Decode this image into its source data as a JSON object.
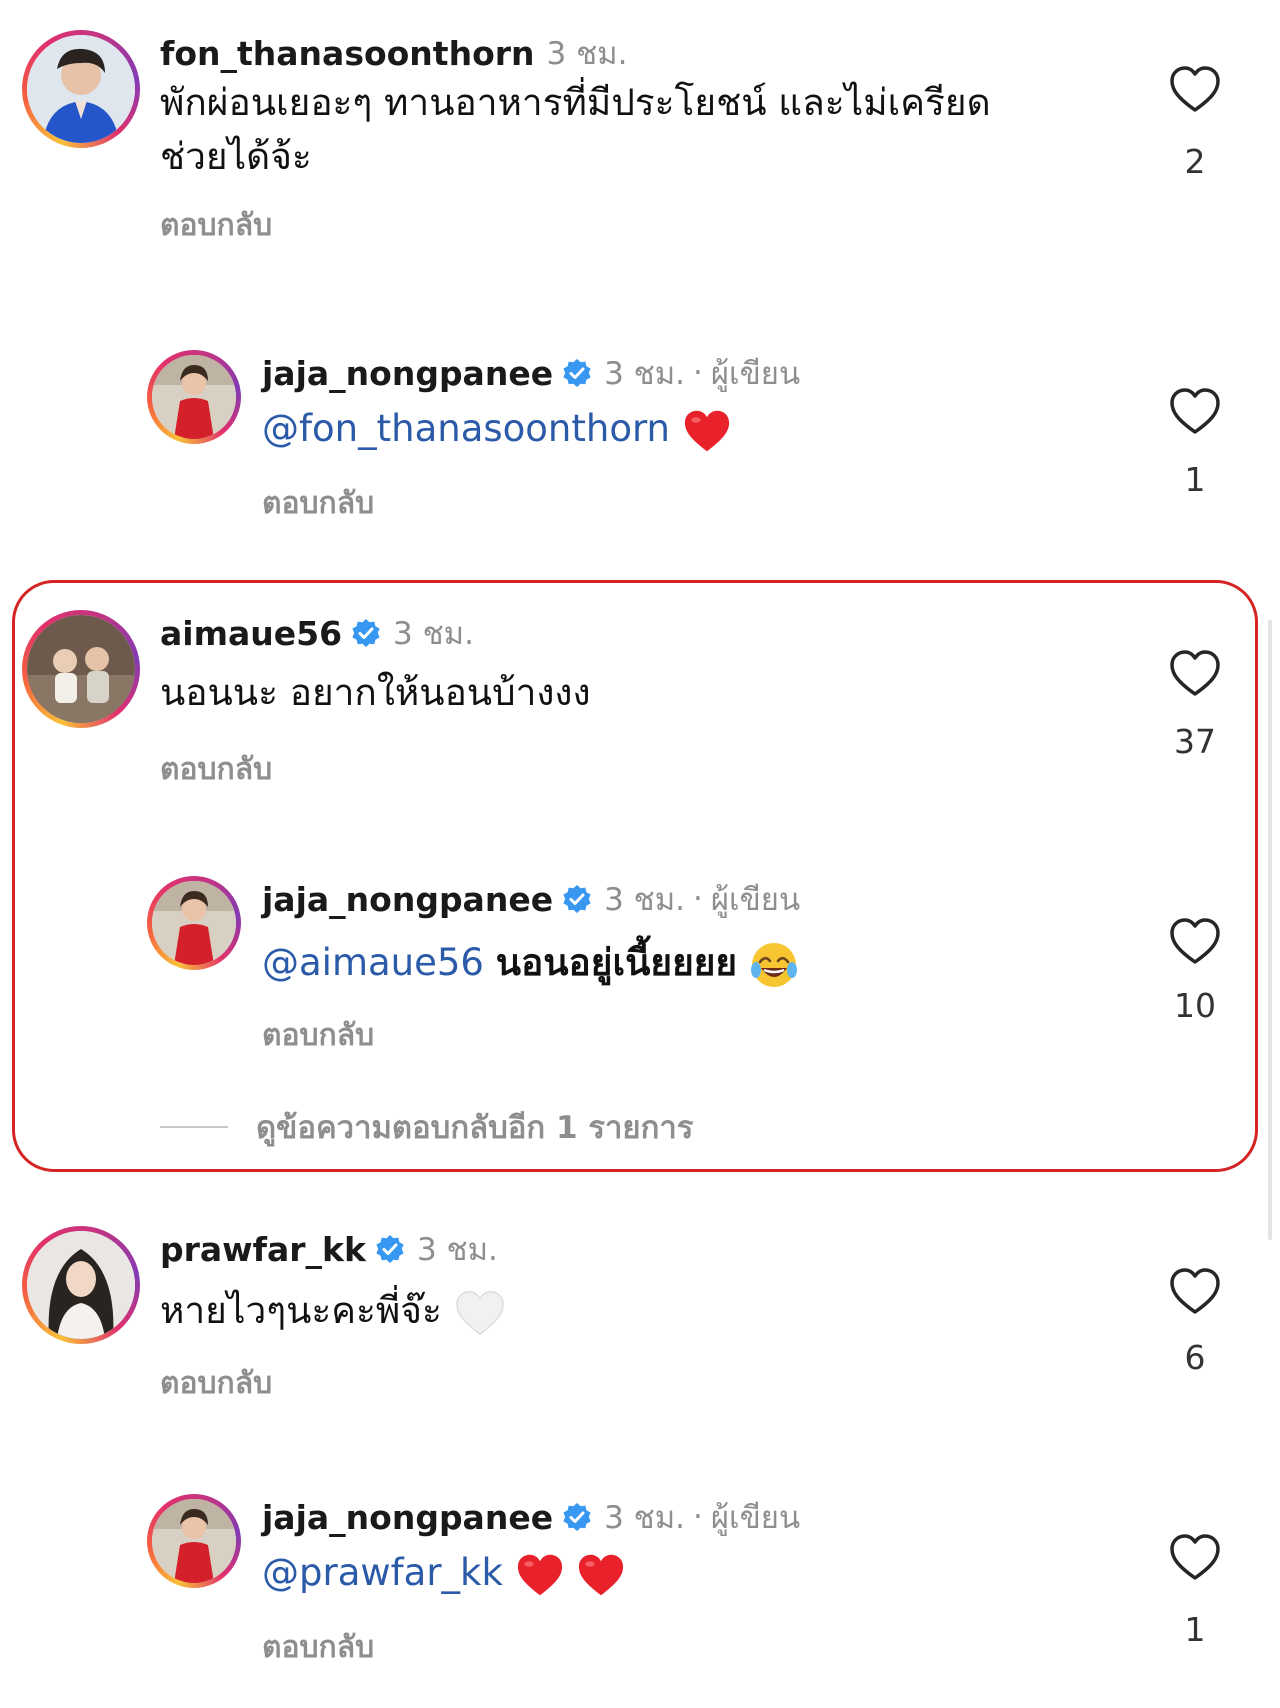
{
  "comments": [
    {
      "username": "fon_thanasoonthorn",
      "time": "3 ชม.",
      "text": "พักผ่อนเยอะๆ ทานอาหารที่มีประโยชน์ และไม่เครียด ช่วยได้จ้ะ",
      "reply_label": "ตอบกลับ",
      "likes": "2"
    },
    {
      "username": "jaja_nongpanee",
      "time": "3 ชม.",
      "author_label": "ผู้เขียน",
      "mention": "@fon_thanasoonthorn",
      "text": "",
      "reply_label": "ตอบกลับ",
      "likes": "1"
    },
    {
      "username": "aimaue56",
      "time": "3 ชม.",
      "text": "นอนนะ อยากให้นอนบ้างงง",
      "reply_label": "ตอบกลับ",
      "likes": "37"
    },
    {
      "username": "jaja_nongpanee",
      "time": "3 ชม.",
      "author_label": "ผู้เขียน",
      "mention": "@aimaue56",
      "text": "นอนอยู่เนี้ยยยย",
      "reply_label": "ตอบกลับ",
      "likes": "10"
    },
    {
      "username": "prawfar_kk",
      "time": "3 ชม.",
      "text": "หายไวๆนะคะพี่จ๊ะ",
      "reply_label": "ตอบกลับ",
      "likes": "6"
    },
    {
      "username": "jaja_nongpanee",
      "time": "3 ชม.",
      "author_label": "ผู้เขียน",
      "mention": "@prawfar_kk",
      "text": "",
      "reply_label": "ตอบกลับ",
      "likes": "1"
    }
  ],
  "more_replies": "ดูข้อความตอบกลับอีก 1 รายการ",
  "colors": {
    "highlight": "#d42424",
    "verified": "#3897f0",
    "mention": "#2b5aa8",
    "muted": "#8e8e8e"
  }
}
